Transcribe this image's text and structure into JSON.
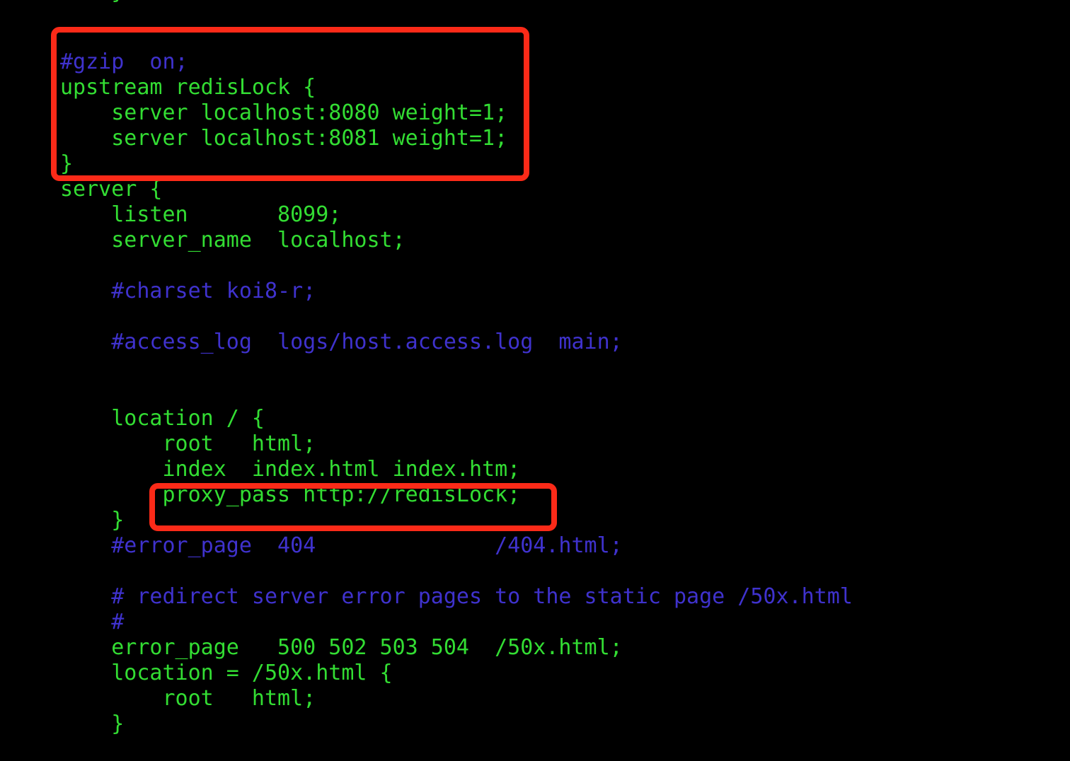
{
  "terminal": {
    "background_color": "#000000",
    "code_color": "#33dd33",
    "comment_color": "#3f32cd",
    "highlight_color": "#fb2a18",
    "font_size_px": 30,
    "line_height_px": 36,
    "clipped_top_line": "    }"
  },
  "file": {
    "language": "nginx-conf",
    "lines": [
      {
        "text": "#gzip  on;",
        "type": "comment"
      },
      {
        "text": "upstream redisLock {",
        "type": "code"
      },
      {
        "text": "    server localhost:8080 weight=1;",
        "type": "code"
      },
      {
        "text": "    server localhost:8081 weight=1;",
        "type": "code"
      },
      {
        "text": "}",
        "type": "code"
      },
      {
        "text": "server {",
        "type": "code"
      },
      {
        "text": "    listen       8099;",
        "type": "code"
      },
      {
        "text": "    server_name  localhost;",
        "type": "code"
      },
      {
        "text": "",
        "type": "code"
      },
      {
        "text": "    #charset koi8-r;",
        "type": "comment"
      },
      {
        "text": "",
        "type": "code"
      },
      {
        "text": "    #access_log  logs/host.access.log  main;",
        "type": "comment"
      },
      {
        "text": "",
        "type": "code"
      },
      {
        "text": "",
        "type": "code"
      },
      {
        "text": "    location / {",
        "type": "code"
      },
      {
        "text": "        root   html;",
        "type": "code"
      },
      {
        "text": "        index  index.html index.htm;",
        "type": "code"
      },
      {
        "text": "        proxy_pass http://redisLock;",
        "type": "code"
      },
      {
        "text": "    }",
        "type": "code"
      },
      {
        "text": "    #error_page  404              /404.html;",
        "type": "comment"
      },
      {
        "text": "",
        "type": "code"
      },
      {
        "text": "    # redirect server error pages to the static page /50x.html",
        "type": "comment"
      },
      {
        "text": "    #",
        "type": "comment"
      },
      {
        "text": "    error_page   500 502 503 504  /50x.html;",
        "type": "code"
      },
      {
        "text": "    location = /50x.html {",
        "type": "code"
      },
      {
        "text": "        root   html;",
        "type": "code"
      },
      {
        "text": "    }",
        "type": "code"
      }
    ]
  },
  "annotations": [
    {
      "id": "upstream-block-highlight",
      "label": "upstream redisLock block",
      "color": "#fb2a18"
    },
    {
      "id": "proxy-pass-highlight",
      "label": "proxy_pass http://redisLock;",
      "color": "#fb2a18"
    }
  ]
}
